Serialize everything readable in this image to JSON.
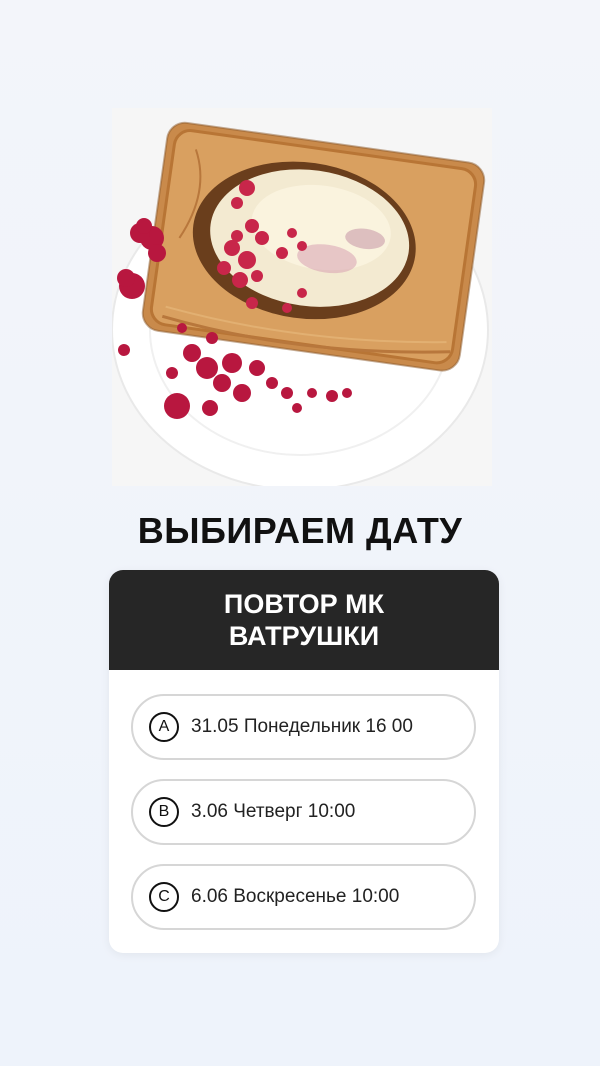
{
  "story": {
    "photo_alt": "Ватрушка из слоёного теста с малиной",
    "heading": "ВЫБИРАЕМ ДАТУ",
    "poll": {
      "title": "ПОВТОР МК\nВАТРУШКИ",
      "options": [
        {
          "letter": "A",
          "label": "31.05 Понедельник 16 00"
        },
        {
          "letter": "B",
          "label": "3.06 Четверг 10:00"
        },
        {
          "letter": "C",
          "label": "6.06 Воскресенье 10:00"
        }
      ]
    }
  }
}
